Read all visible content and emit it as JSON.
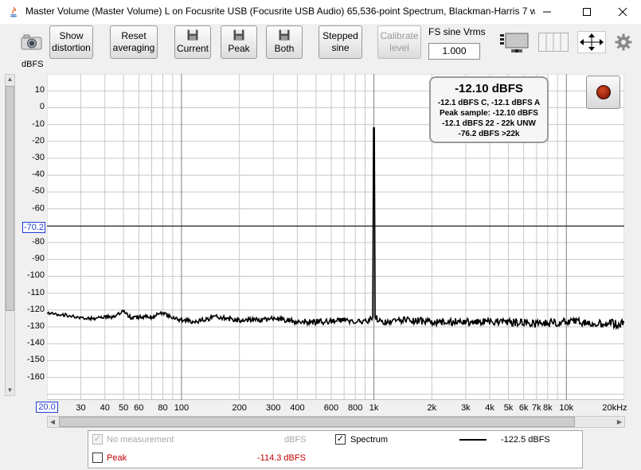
{
  "window": {
    "title": "Master Volume (Master Volume) L on Focusrite USB (Focusrite USB Audio) 65,536-point Spectrum, Blackman-Harris 7 w..."
  },
  "toolbar": {
    "show_distortion": "Show\ndistortion",
    "reset_averaging": "Reset\naveraging",
    "current": "Current",
    "peak": "Peak",
    "both": "Both",
    "stepped_sine": "Stepped\nsine",
    "calibrate_level": "Calibrate\nlevel",
    "fs_label": "FS sine Vrms",
    "fs_value": "1.000"
  },
  "plot": {
    "unit_label": "dBFS",
    "y_cursor": "-70.2",
    "x_cursor": "20.0"
  },
  "readout": {
    "main": "-12.10 dBFS",
    "line1": "-12.1 dBFS C, -12.1 dBFS A",
    "line2": "Peak sample: -12.10 dBFS",
    "line3": "-12.1 dBFS 22 - 22k UNW",
    "line4": "-76.2 dBFS >22k"
  },
  "legend": {
    "no_measurement": "No measurement",
    "no_measurement_value": "dBFS",
    "spectrum": "Spectrum",
    "spectrum_value": "-122.5 dBFS",
    "peak": "Peak",
    "peak_value": "-114.3 dBFS"
  },
  "colors": {
    "cursor_blue": "#1f3bd6",
    "peak_red": "#c00000",
    "trace": "#000000"
  },
  "chart_data": {
    "type": "line",
    "xscale": "log",
    "xlim": [
      20,
      20000
    ],
    "ylim": [
      -170,
      20
    ],
    "ylabel": "dBFS",
    "y_ticks": [
      "10",
      "0",
      "-10",
      "-20",
      "-30",
      "-40",
      "-50",
      "-60",
      "-70.2",
      "-80",
      "-90",
      "-100",
      "-110",
      "-120",
      "-130",
      "-140",
      "-150",
      "-160"
    ],
    "x_ticks": [
      "20.0",
      "30",
      "40",
      "50",
      "60",
      "80",
      "100",
      "200",
      "300",
      "400",
      "600",
      "800",
      "1k",
      "2k",
      "3k",
      "4k",
      "5k",
      "6k",
      "7k",
      "8k",
      "10k",
      "20kHz"
    ],
    "cursor_y": -70.2,
    "series": [
      {
        "name": "Spectrum",
        "x": [
          20,
          25,
          30,
          35,
          40,
          45,
          50,
          55,
          60,
          70,
          80,
          90,
          100,
          120,
          150,
          200,
          250,
          300,
          400,
          500,
          600,
          700,
          800,
          900,
          980,
          1000,
          1020,
          1100,
          1500,
          2000,
          3000,
          5000,
          7000,
          10000,
          15000,
          20000
        ],
        "y": [
          -122,
          -123,
          -125,
          -125,
          -124,
          -124,
          -121,
          -125,
          -124,
          -124,
          -122,
          -125,
          -126,
          -127,
          -124,
          -126,
          -126,
          -125,
          -127,
          -127,
          -127,
          -126,
          -127,
          -127,
          -125,
          -12,
          -127,
          -127,
          -126,
          -127,
          -127,
          -127,
          -128,
          -127,
          -128,
          -128
        ]
      }
    ]
  }
}
